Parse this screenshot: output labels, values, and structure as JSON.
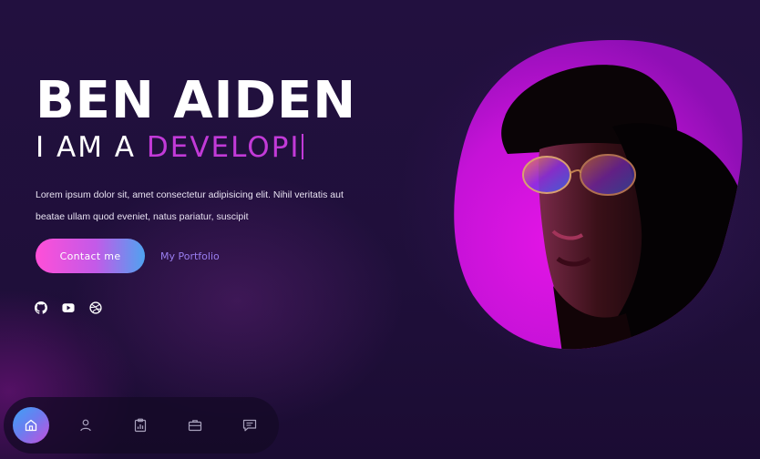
{
  "hero": {
    "name": "BEN AIDEN",
    "role_prefix": "I AM A ",
    "role_typed": "DEVELOPI",
    "description": "Lorem ipsum dolor sit, amet consectetur adipisicing elit. Nihil veritatis aut beatae ullam quod eveniet, natus pariatur, suscipit"
  },
  "actions": {
    "contact_label": "Contact me",
    "portfolio_label": "My Portfolio"
  },
  "socials": [
    "github-icon",
    "youtube-icon",
    "dribbble-icon"
  ],
  "bottom_nav": {
    "items": [
      "home-icon",
      "user-icon",
      "clipboard-chart-icon",
      "briefcase-icon",
      "message-icon"
    ],
    "active": "home-icon"
  },
  "colors": {
    "background": "#22103f",
    "accent_text": "#c23ad8",
    "portfolio_link": "#9a7ef0",
    "button_gradient": [
      "#ff4fd8",
      "#c35ae8",
      "#4fa3f0"
    ],
    "nav_active_gradient": [
      "#3da1f5",
      "#6a7ef0",
      "#c54fdc"
    ],
    "photo_blob": "#cf14d9"
  },
  "photo": {
    "subject": "portrait-photo"
  }
}
